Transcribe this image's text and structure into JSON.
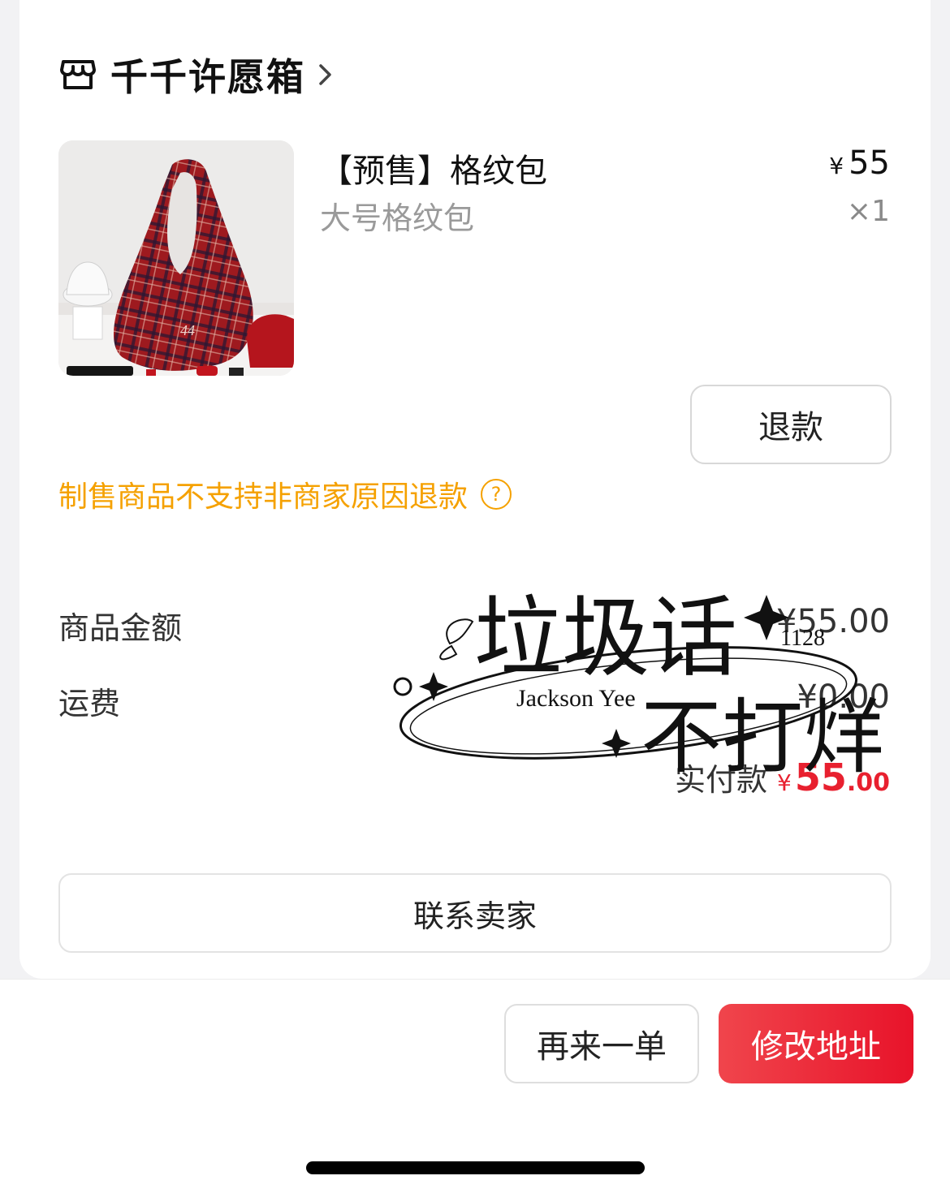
{
  "store": {
    "name": "千千许愿箱",
    "icon": "store-icon"
  },
  "product": {
    "title": "【预售】格纹包",
    "spec": "大号格纹包",
    "price_symbol": "¥",
    "price": "55",
    "quantity": "×1",
    "image": "red-plaid-tote-bag-photo"
  },
  "actions": {
    "refund_label": "退款"
  },
  "notice": {
    "text": "制售商品不支持非商家原因退款",
    "help": "?"
  },
  "summary": {
    "goods_label": "商品金额",
    "goods_value": "¥55.00",
    "shipping_label": "运费",
    "shipping_value": "¥0.00",
    "paid_label": "实付款",
    "paid_symbol": "¥",
    "paid_integer": "55",
    "paid_decimal": ".00"
  },
  "watermark": {
    "line1": "垃圾话",
    "line2": "不打烊",
    "name": "Jackson Yee",
    "number": "1128"
  },
  "contact": {
    "label": "联系卖家"
  },
  "bottom": {
    "reorder_label": "再来一单",
    "modify_label": "修改地址"
  },
  "colors": {
    "accent_red": "#e8202f",
    "notice_orange": "#f5a100"
  }
}
